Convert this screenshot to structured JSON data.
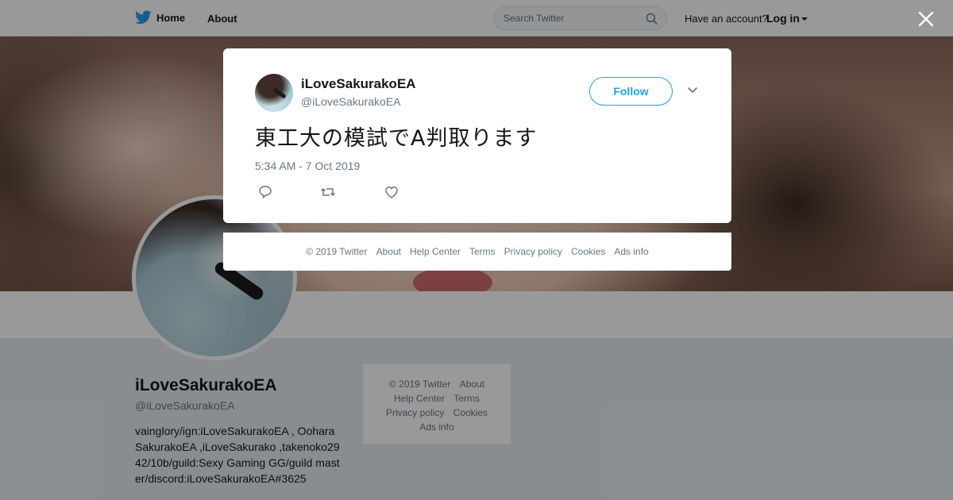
{
  "topbar": {
    "home_label": "Home",
    "about_label": "About",
    "search_placeholder": "Search Twitter",
    "have_account": "Have an account?",
    "login_label": "Log in",
    "brand_color": "#1da1f2"
  },
  "profile": {
    "name": "iLoveSakurakoEA",
    "handle": "@iLoveSakurakoEA",
    "bio": "vainglory/ign:iLoveSakurakoEA , OoharaSakurakoEA ,iLoveSakurako ,takenoko2942/10b/guild:Sexy Gaming GG/guild master/discord:iLoveSakurakoEA#3625"
  },
  "side_footer": {
    "copyright": "© 2019 Twitter",
    "about": "About",
    "help_center": "Help Center",
    "terms": "Terms",
    "privacy": "Privacy policy",
    "cookies": "Cookies",
    "ads_info": "Ads info"
  },
  "tweet": {
    "author_name": "iLoveSakurakoEA",
    "author_handle": "@iLoveSakurakoEA",
    "follow_label": "Follow",
    "text": "東工大の模試でA判取ります",
    "timestamp": "5:34 AM - 7 Oct 2019",
    "action_icons": [
      "reply-icon",
      "retweet-icon",
      "like-icon"
    ]
  },
  "footer": {
    "copyright": "© 2019 Twitter",
    "about": "About",
    "help_center": "Help Center",
    "terms": "Terms",
    "privacy": "Privacy policy",
    "cookies": "Cookies",
    "ads_info": "Ads info"
  }
}
